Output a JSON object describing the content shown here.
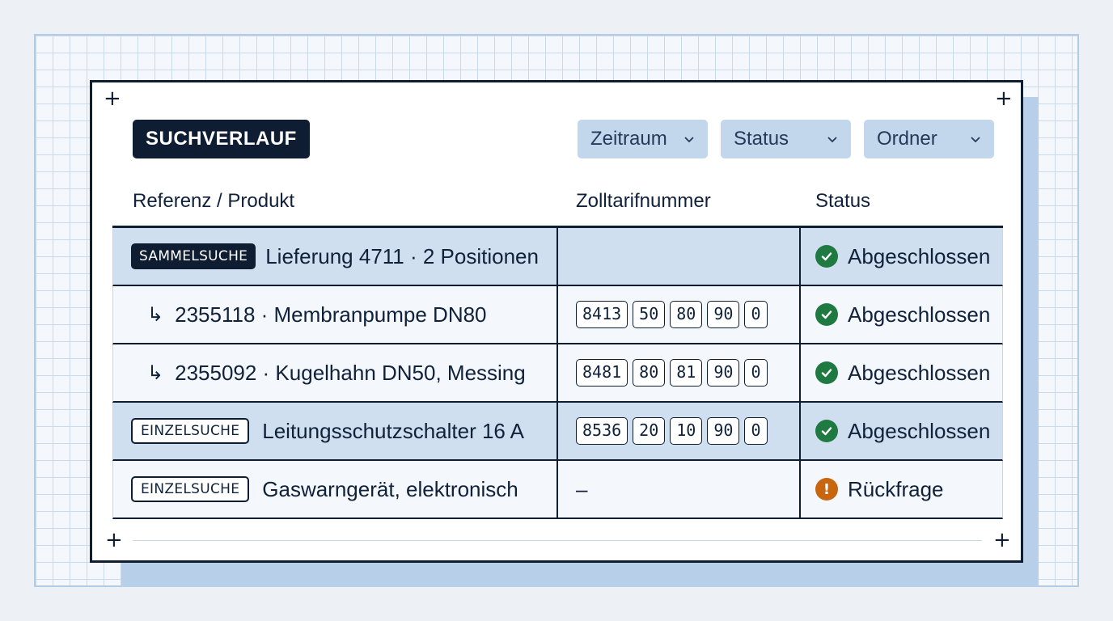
{
  "page": {
    "title": "SUCHVERLAUF",
    "filters": [
      {
        "label": "Zeitraum"
      },
      {
        "label": "Status"
      },
      {
        "label": "Ordner"
      }
    ]
  },
  "table": {
    "headers": {
      "reference": "Referenz / Produkt",
      "tariff": "Zolltarifnummer",
      "status": "Status"
    },
    "rows": [
      {
        "tag": "SAMMELSUCHE",
        "text": "Lieferung 4711 · 2 Positionen",
        "code": [],
        "status": "Abgeschlossen"
      },
      {
        "text": "2355118 · Membranpumpe DN80",
        "code": [
          "8413",
          "50",
          "80",
          "90",
          "0"
        ],
        "status": "Abgeschlossen"
      },
      {
        "text": "2355092 · Kugelhahn DN50, Messing",
        "code": [
          "8481",
          "80",
          "81",
          "90",
          "0"
        ],
        "status": "Abgeschlossen"
      },
      {
        "tag": "EINZELSUCHE",
        "text": "Leitungsschutzschalter 16 A",
        "code": [
          "8536",
          "20",
          "10",
          "90",
          "0"
        ],
        "status": "Abgeschlossen"
      },
      {
        "tag": "EINZELSUCHE",
        "text": "Gaswarngerät, elektronisch",
        "code_placeholder": "–",
        "status": "Rückfrage"
      }
    ]
  },
  "icons": {
    "child_arrow": "↳",
    "ok": "check-circle-icon",
    "warn": "exclamation-circle-icon",
    "warn_glyph": "!"
  },
  "colors": {
    "ok": "#1f7a42",
    "warn": "#c8650f",
    "accent_row": "#cfdff0",
    "dark": "#0f1d33"
  }
}
